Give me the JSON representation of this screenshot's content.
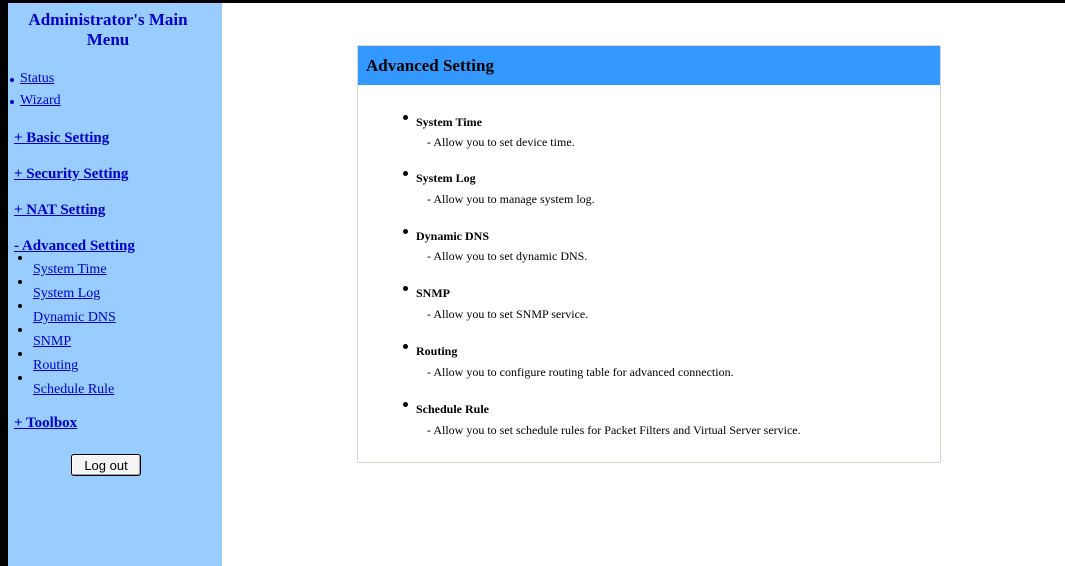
{
  "sidebar": {
    "title_line1": "Administrator's Main",
    "title_line2": "Menu",
    "top_links": [
      "Status",
      "Wizard"
    ],
    "sections": [
      {
        "label": "+ Basic Setting"
      },
      {
        "label": "+ Security Setting"
      },
      {
        "label": "+ NAT Setting"
      },
      {
        "label": "- Advanced Setting"
      },
      {
        "label": "+ Toolbox"
      }
    ],
    "advanced_items": [
      "System Time",
      "System Log",
      "Dynamic DNS",
      "SNMP",
      "Routing",
      "Schedule Rule"
    ],
    "logout_label": "Log out"
  },
  "main": {
    "title": "Advanced Setting",
    "items": [
      {
        "title": "System Time",
        "desc": "- Allow you to set device time."
      },
      {
        "title": "System Log",
        "desc": "- Allow you to manage system log."
      },
      {
        "title": "Dynamic DNS",
        "desc": "- Allow you to set dynamic DNS."
      },
      {
        "title": "SNMP",
        "desc": "- Allow you to set SNMP service."
      },
      {
        "title": "Routing",
        "desc": "- Allow you to configure routing table for advanced connection."
      },
      {
        "title": "Schedule Rule",
        "desc": "- Allow you to set schedule rules for Packet Filters and Virtual Server service."
      }
    ]
  },
  "colors": {
    "sidebar_bg": "#99ccff",
    "header_bg": "#3399ff",
    "link": "#0000cc"
  }
}
